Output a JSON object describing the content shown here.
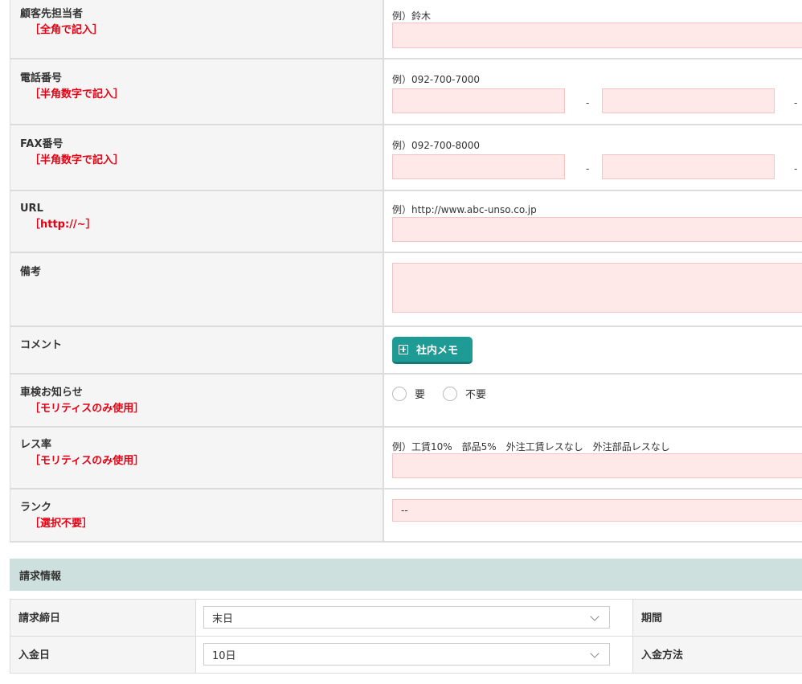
{
  "form": {
    "rows": [
      {
        "label": "顧客先担当者",
        "note": "［全角で記入］",
        "example": "例）鈴木"
      },
      {
        "label": "電話番号",
        "note": "［半角数字で記入］",
        "example": "例）092-700-7000"
      },
      {
        "label": "FAX番号",
        "note": "［半角数字で記入］",
        "example": "例）092-700-8000"
      },
      {
        "label": "URL",
        "note": "［http://~］",
        "example": "例）http://www.abc-unso.co.jp"
      },
      {
        "label": "備考"
      },
      {
        "label": "コメント",
        "button": "社内メモ"
      },
      {
        "label": "車検お知らせ",
        "note": "［モリティスのみ使用］",
        "options": [
          "要",
          "不要"
        ]
      },
      {
        "label": "レス率",
        "note": "［モリティスのみ使用］",
        "example": "例）工賃10%　部品5%　外注工賃レスなし　外注部品レスなし"
      },
      {
        "label": "ランク",
        "note": "［選択不要］",
        "select_value": "--"
      }
    ],
    "dash": "-"
  },
  "billing": {
    "header": "請求情報",
    "rows": [
      {
        "label": "請求締日",
        "value": "末日",
        "right_label": "期間"
      },
      {
        "label": "入金日",
        "value": "10日",
        "right_label": "入金方法"
      }
    ]
  }
}
